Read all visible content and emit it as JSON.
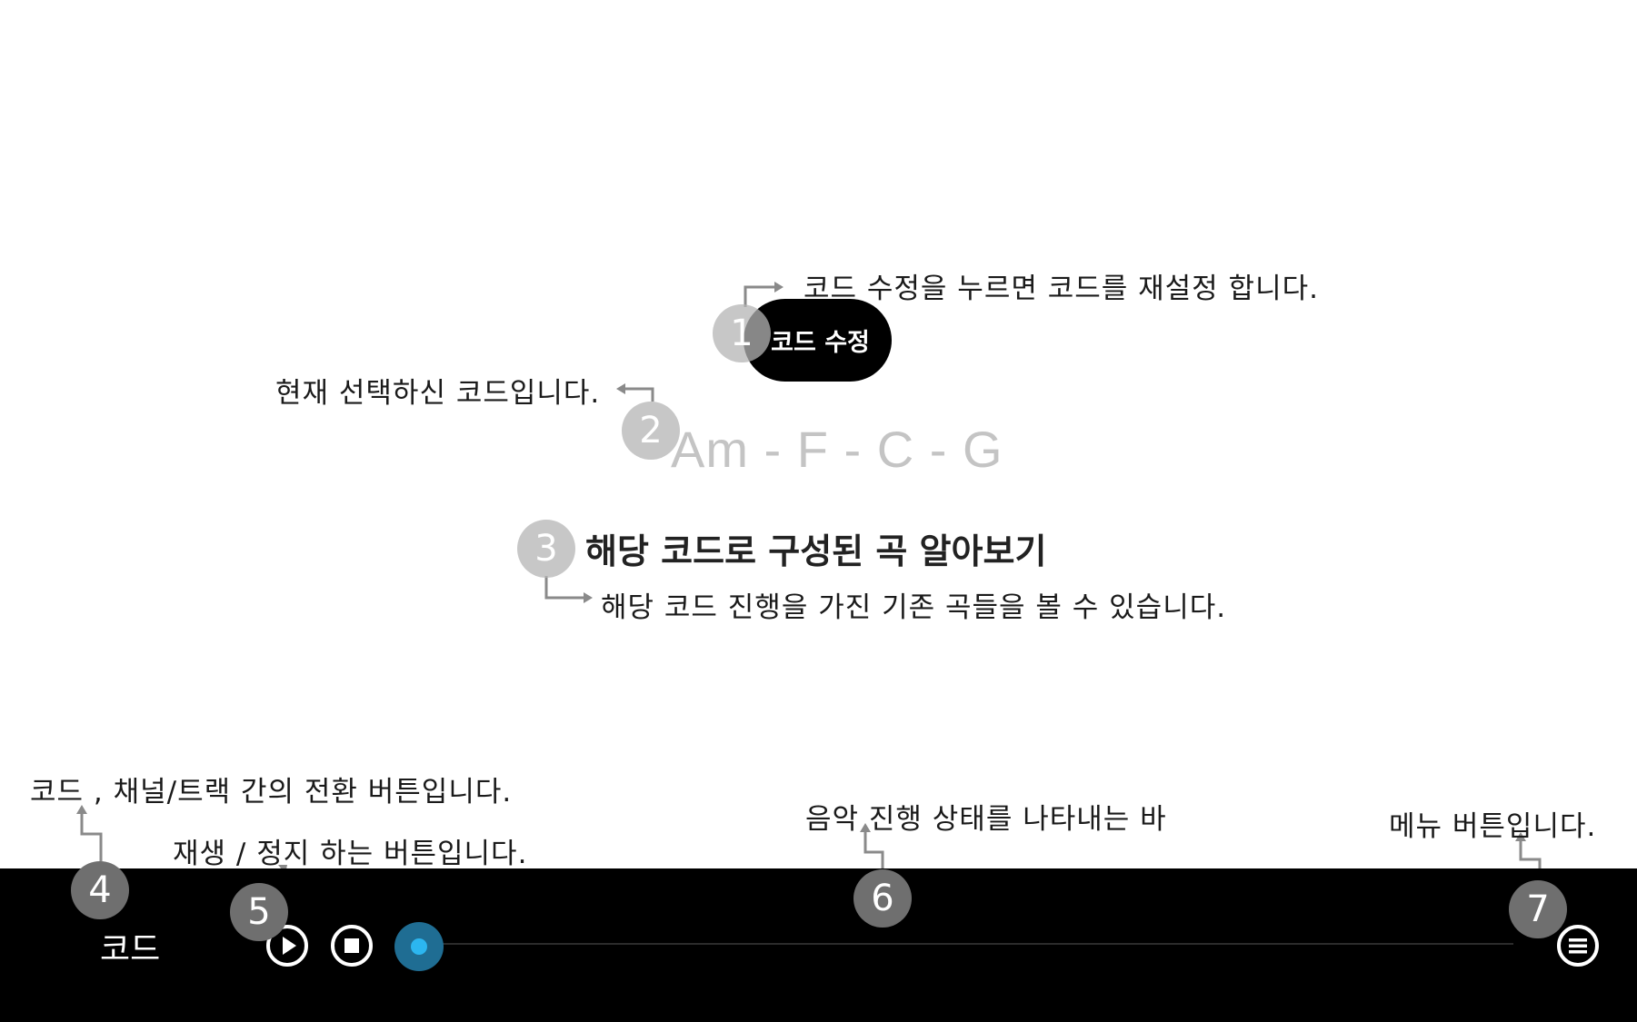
{
  "edit_button": {
    "label": "코드 수정"
  },
  "chord_progression": "Am - F - C - G",
  "songs_link": {
    "label": "해당 코드로 구성된 곡 알아보기"
  },
  "bottom_bar": {
    "mode_label": "코드",
    "progress": 0.0
  },
  "annotations": [
    {
      "number": "1",
      "text": "코드 수정을 누르면 코드를 재설정 합니다."
    },
    {
      "number": "2",
      "text": "현재 선택하신 코드입니다."
    },
    {
      "number": "3",
      "text": "해당 코드 진행을 가진 기존 곡들을 볼 수 있습니다."
    },
    {
      "number": "4",
      "text": "코드 , 채널/트랙 간의 전환 버튼입니다."
    },
    {
      "number": "5",
      "text": "재생 / 정지 하는 버튼입니다."
    },
    {
      "number": "6",
      "text": "음악 진행 상태를 나타내는 바"
    },
    {
      "number": "7",
      "text": "메뉴 버튼입니다."
    }
  ],
  "colors": {
    "bar_background": "#000000",
    "progress_knob": "#2cb6f0",
    "annotation_light": "#b4b4b4",
    "annotation_dark": "#6f6f6f"
  },
  "icons": {
    "play": "play-icon",
    "stop": "stop-icon",
    "menu": "menu-icon"
  }
}
